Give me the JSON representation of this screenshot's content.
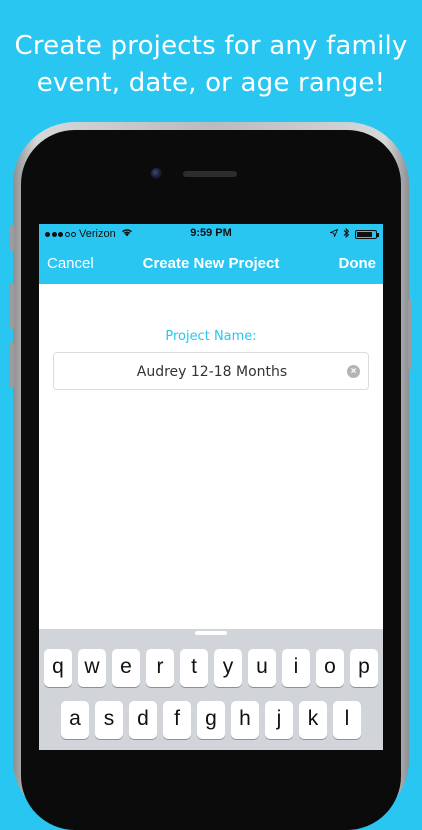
{
  "promo": {
    "line1": "Create projects for any family",
    "line2": "event, date, or age range!"
  },
  "status_bar": {
    "carrier": "Verizon",
    "time": "9:59 PM",
    "signal_bars": 3,
    "battery_level": 0.8
  },
  "nav": {
    "cancel_label": "Cancel",
    "title": "Create New Project",
    "done_label": "Done"
  },
  "form": {
    "project_name_label": "Project Name:",
    "project_name_value": "Audrey 12-18 Months"
  },
  "keyboard": {
    "row1": [
      "q",
      "w",
      "e",
      "r",
      "t",
      "y",
      "u",
      "i",
      "o",
      "p"
    ],
    "row2": [
      "a",
      "s",
      "d",
      "f",
      "g",
      "h",
      "j",
      "k",
      "l"
    ]
  },
  "colors": {
    "accent": "#29c6f2",
    "keyboard_bg": "#d1d4d9",
    "text_dark": "#333333"
  }
}
